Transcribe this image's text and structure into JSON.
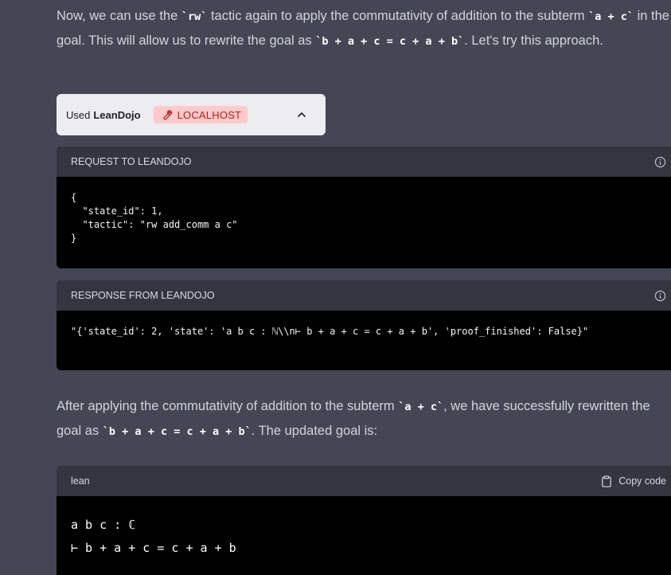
{
  "para1": {
    "t1": "Now, we can use the ",
    "c1": "`rw`",
    "t2": " tactic again to apply the commutativity of addition to the subterm ",
    "c2": "`a + c`",
    "t3": " in the goal. This will allow us to rewrite the goal as ",
    "c3": "`b + a + c = c + a + b`",
    "t4": ". Let's try this approach."
  },
  "plugin": {
    "prefix": "Used",
    "name": "LeanDojo",
    "badge": "LOCALHOST"
  },
  "request": {
    "header": "REQUEST TO LEANDOJO",
    "body": "{\n  \"state_id\": 1,\n  \"tactic\": \"rw add_comm a c\"\n}"
  },
  "response": {
    "header": "RESPONSE FROM LEANDOJO",
    "body": "\"{'state_id': 2, 'state': 'a b c : ℕ\\\\n⊢ b + a + c = c + a + b', 'proof_finished': False}\""
  },
  "para2": {
    "t1": "After applying the commutativity of addition to the subterm ",
    "c1": "`a + c`",
    "t2": ", we have successfully rewritten the goal as ",
    "c2": "`b + a + c = c + a + b`",
    "t3": ". The updated goal is:"
  },
  "codeblock": {
    "lang": "lean",
    "copy_label": "Copy code",
    "body": "a b c : ℂ\n⊢ b + a + c = c + a + b"
  }
}
